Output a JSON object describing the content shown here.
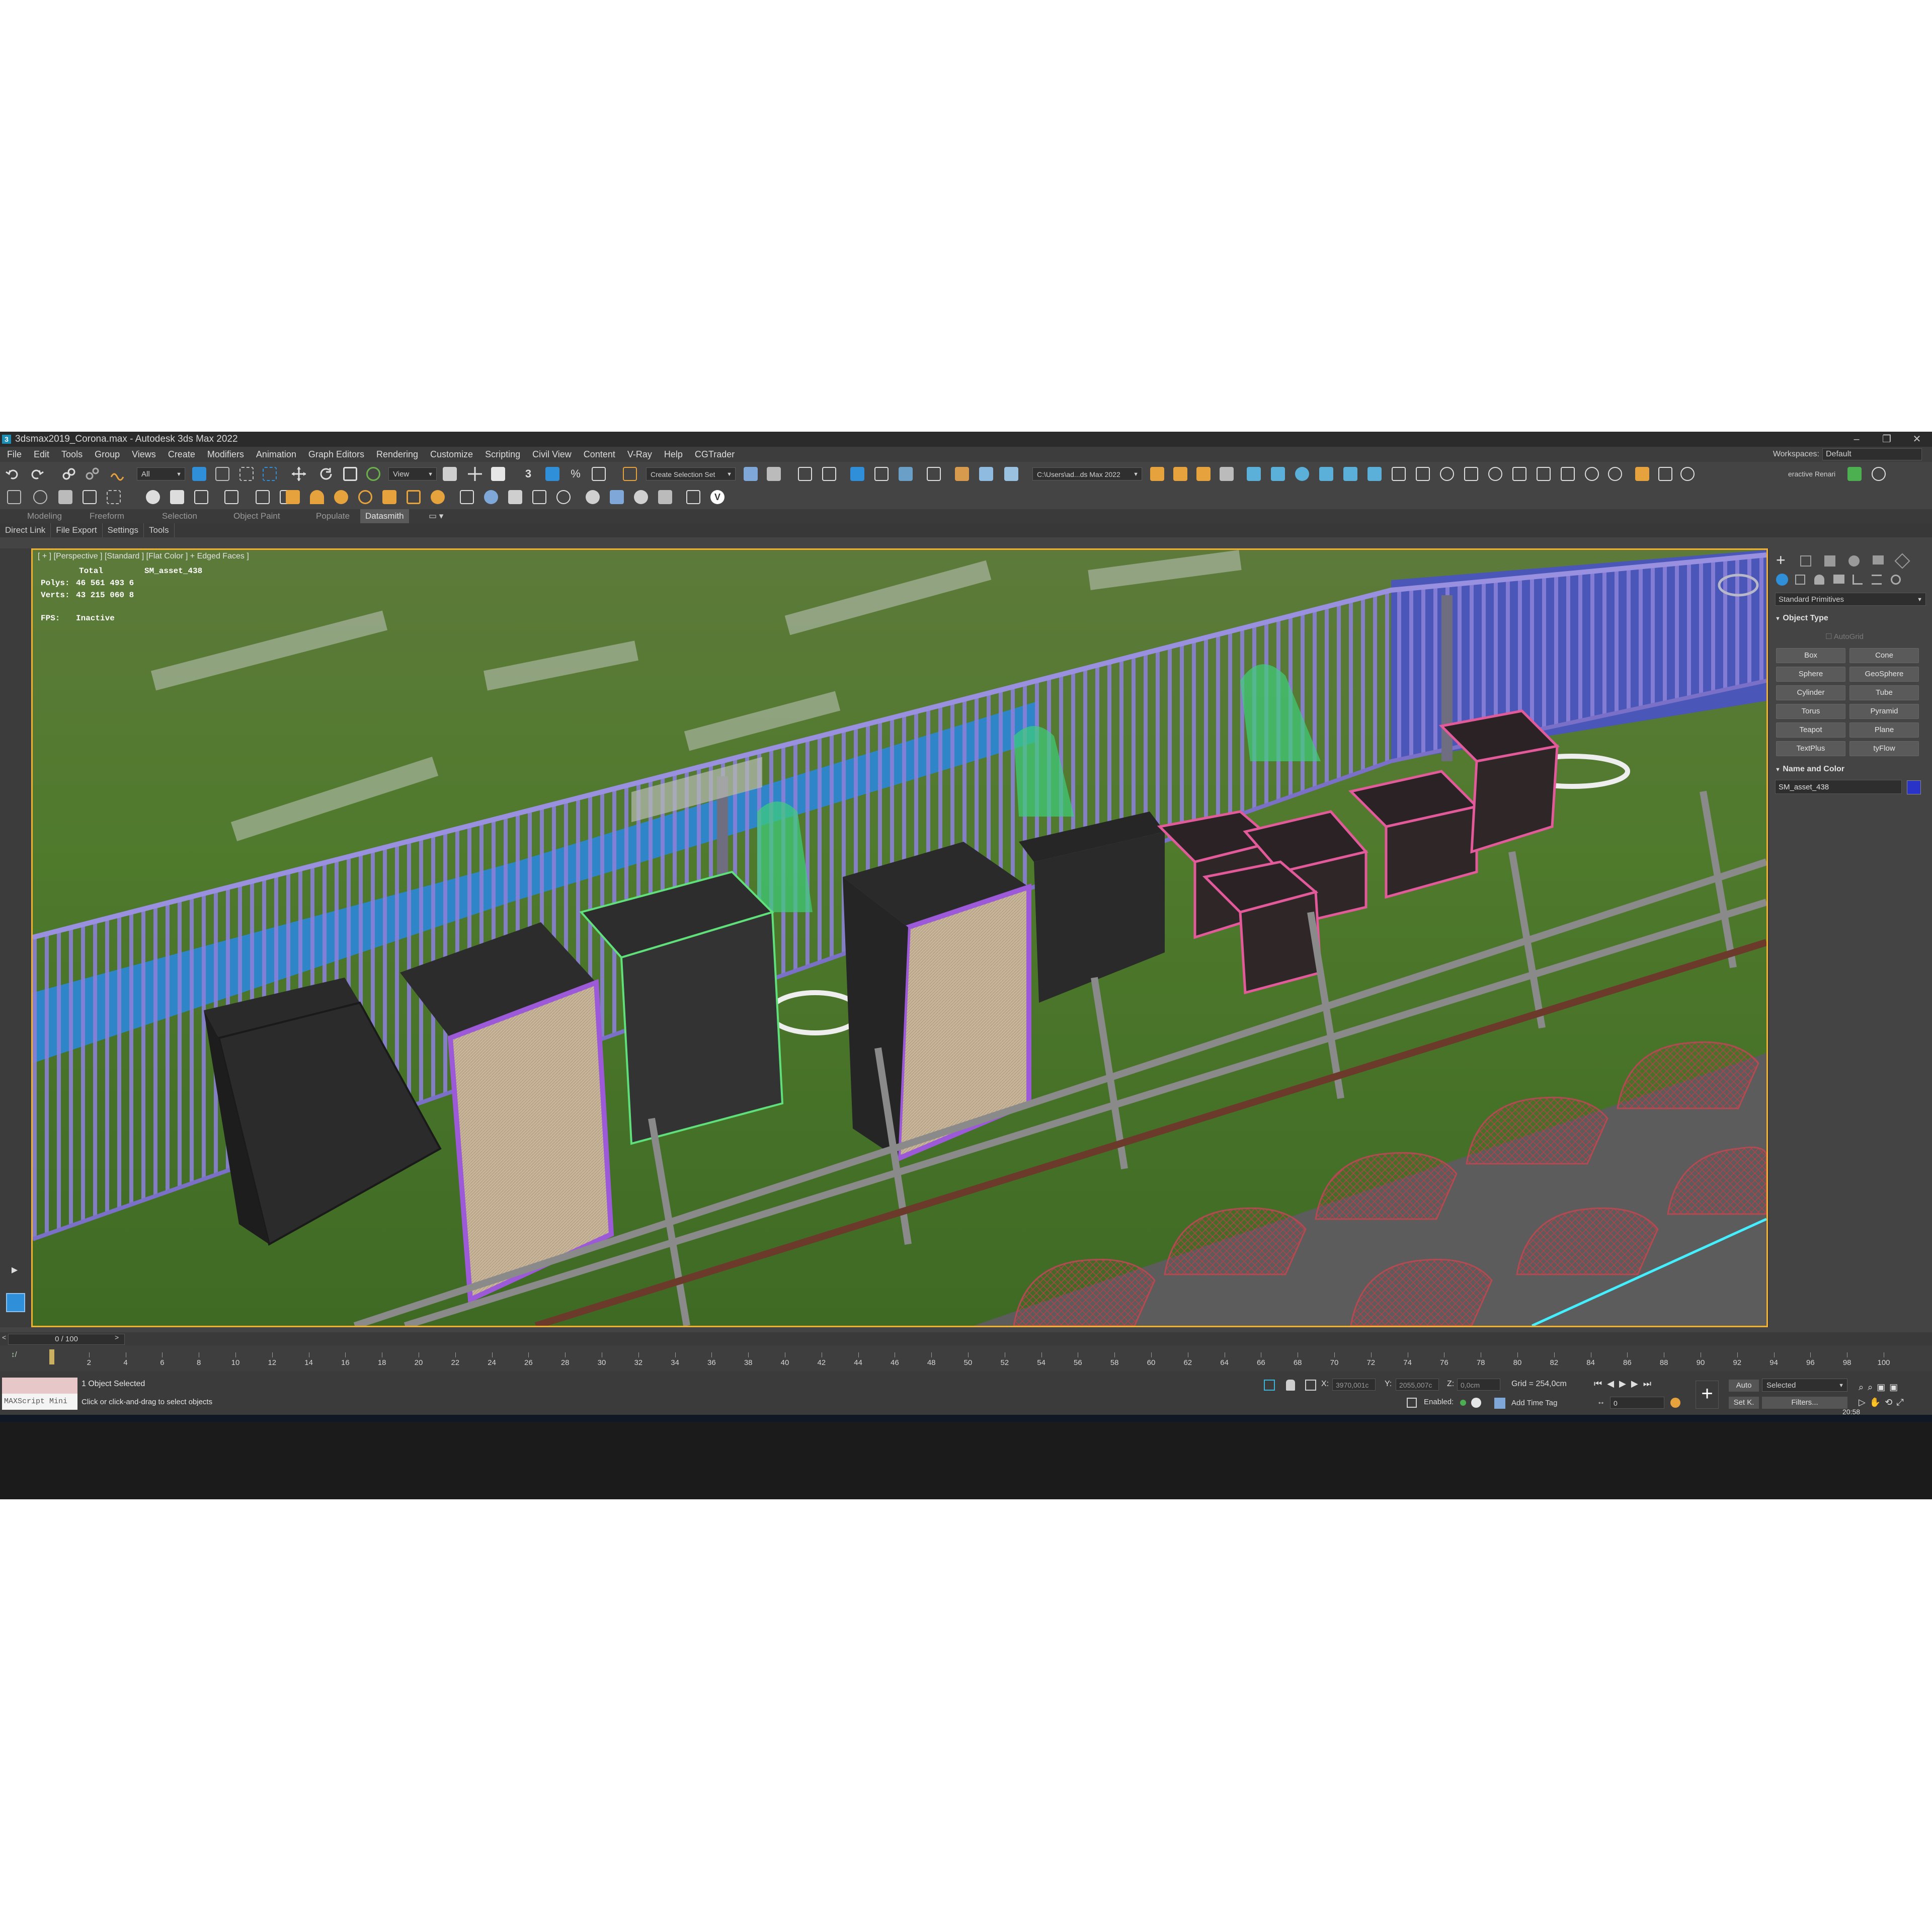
{
  "window": {
    "title": "3dsmax2019_Corona.max - Autodesk 3ds Max 2022",
    "app_icon": "3",
    "controls": [
      "–",
      "❐",
      "✕"
    ]
  },
  "menubar": {
    "items": [
      "File",
      "Edit",
      "Tools",
      "Group",
      "Views",
      "Create",
      "Modifiers",
      "Animation",
      "Graph Editors",
      "Rendering",
      "Customize",
      "Scripting",
      "Civil View",
      "Content",
      "V-Ray",
      "Help",
      "CGTrader"
    ],
    "workspaces_label": "Workspaces:",
    "workspaces_value": "Default"
  },
  "toolbar": {
    "filter_value": "All",
    "refcoord_value": "View",
    "selection_set_value": "Create Selection Set",
    "project_path": "C:\\Users\\ad...ds Max 2022",
    "render_mode": "eractive Renari"
  },
  "ribbon": {
    "tabs": [
      "Modeling",
      "Freeform",
      "Selection",
      "Object Paint",
      "Populate",
      "Datasmith"
    ],
    "active_tab": "Datasmith",
    "sub_items": [
      "Direct Link",
      "File Export",
      "Settings",
      "Tools"
    ]
  },
  "viewport": {
    "label": "[ + ] [Perspective ] [Standard ] [Flat Color ] + Edged Faces ]",
    "stats": {
      "total_label": "Total",
      "object_name": "SM_asset_438",
      "polys_label": "Polys:",
      "polys_value": "46 561 493 6",
      "verts_label": "Verts:",
      "verts_value": "43 215 060 8",
      "fps_label": "FPS:",
      "fps_value": "Inactive"
    }
  },
  "command_panel": {
    "category": "Standard Primitives",
    "object_type_title": "Object Type",
    "autogrid": "AutoGrid",
    "buttons": [
      "Box",
      "Cone",
      "Sphere",
      "GeoSphere",
      "Cylinder",
      "Tube",
      "Torus",
      "Pyramid",
      "Teapot",
      "Plane",
      "TextPlus",
      "tyFlow"
    ],
    "name_color_title": "Name and Color",
    "object_name": "SM_asset_438",
    "object_color": "#2a33c8"
  },
  "timeline": {
    "frame_display": "0 / 100",
    "ticks": [
      2,
      4,
      6,
      8,
      10,
      12,
      14,
      16,
      18,
      20,
      22,
      24,
      26,
      28,
      30,
      32,
      34,
      36,
      38,
      40,
      42,
      44,
      46,
      48,
      50,
      52,
      54,
      56,
      58,
      60,
      62,
      64,
      66,
      68,
      70,
      72,
      74,
      76,
      78,
      80,
      82,
      84,
      86,
      88,
      90,
      92,
      94,
      96,
      98,
      100
    ]
  },
  "statusbar": {
    "maxscript_label": "MAXScript Mini",
    "selection_status": "1 Object Selected",
    "prompt": "Click or click-and-drag to select objects",
    "x_label": "X:",
    "x_value": "3970,001c",
    "y_label": "Y:",
    "y_value": "2055,007c",
    "z_label": "Z:",
    "z_value": "0,0cm",
    "grid": "Grid = 254,0cm",
    "enabled_label": "Enabled:",
    "add_time_tag": "Add Time Tag",
    "auto_label": "Auto",
    "selected_value": "Selected",
    "setk_label": "Set K.",
    "filters_label": "Filters...",
    "frame_value": "0"
  },
  "taskbar": {
    "clock": "20:58"
  },
  "colors": {
    "ui_bg": "#444444",
    "viewport_border": "#f0b030",
    "selection_highlight": "#2f8fd8"
  }
}
